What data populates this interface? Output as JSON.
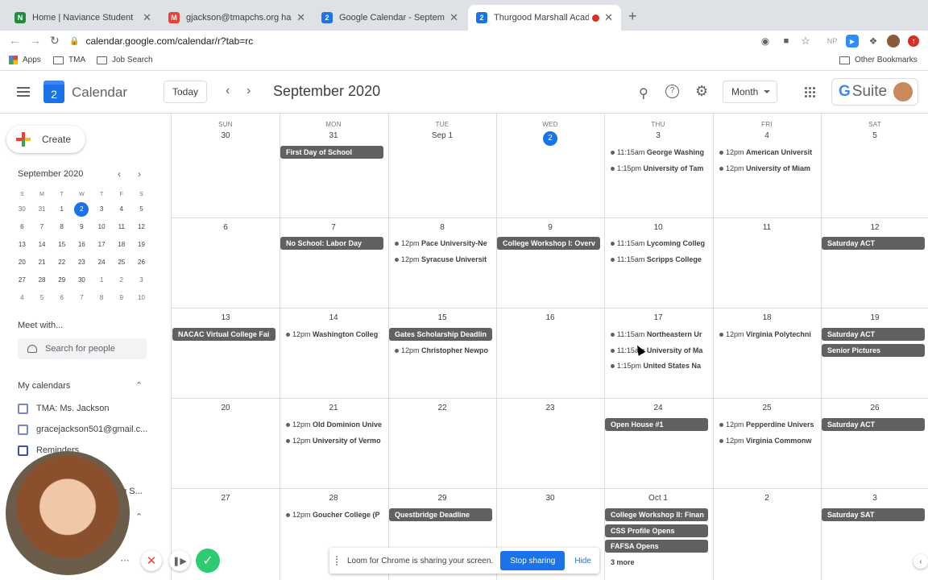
{
  "browser": {
    "tabs": [
      {
        "title": "Home | Naviance Student",
        "favicon_color": "#1e8e3e",
        "favicon": "N"
      },
      {
        "title": "gjackson@tmapchs.org has sh",
        "favicon_color": "#ea4335",
        "favicon": "M"
      },
      {
        "title": "Google Calendar - September",
        "favicon_color": "#1a73e8",
        "favicon": "2"
      },
      {
        "title": "Thurgood Marshall Academ",
        "favicon_color": "#1a73e8",
        "favicon": "2",
        "active": true
      }
    ],
    "url": "calendar.google.com/calendar/r?tab=rc",
    "bookmarks": [
      {
        "label": "Apps",
        "icon": "apps-grid-icon"
      },
      {
        "label": "TMA",
        "icon": "folder-icon"
      },
      {
        "label": "Job Search",
        "icon": "folder-icon"
      }
    ],
    "other_bookmarks": "Other Bookmarks",
    "ext_np": "NP"
  },
  "header": {
    "logo_day": "2",
    "app_name": "Calendar",
    "today_label": "Today",
    "title": "September 2020",
    "view_label": "Month",
    "gsuite_label": "Suite",
    "gsuite_g": "G"
  },
  "sidebar": {
    "create_label": "Create",
    "mini_title": "September 2020",
    "mini_dow": [
      "S",
      "M",
      "T",
      "W",
      "T",
      "F",
      "S"
    ],
    "mini_weeks": [
      [
        "30",
        "31",
        "1",
        "2",
        "3",
        "4",
        "5"
      ],
      [
        "6",
        "7",
        "8",
        "9",
        "10",
        "11",
        "12"
      ],
      [
        "13",
        "14",
        "15",
        "16",
        "17",
        "18",
        "19"
      ],
      [
        "20",
        "21",
        "22",
        "23",
        "24",
        "25",
        "26"
      ],
      [
        "27",
        "28",
        "29",
        "30",
        "1",
        "2",
        "3"
      ],
      [
        "4",
        "5",
        "6",
        "7",
        "8",
        "9",
        "10"
      ]
    ],
    "meet_with": "Meet with...",
    "search_people": "Search for people",
    "my_calendars": "My calendars",
    "calendars": [
      {
        "label": "TMA: Ms. Jackson",
        "color": "#7986cb"
      },
      {
        "label": "gracejackson501@gmail.c...",
        "color": "#7986cb"
      },
      {
        "label": "Reminders",
        "color": "#3f51b5"
      }
    ],
    "partial_label": "ng S..."
  },
  "grid": {
    "dow": [
      "SUN",
      "MON",
      "TUE",
      "WED",
      "THU",
      "FRI",
      "SAT"
    ],
    "weeks": [
      [
        "30",
        "31",
        "Sep 1",
        "2",
        "3",
        "4",
        "5"
      ],
      [
        "6",
        "7",
        "8",
        "9",
        "10",
        "11",
        "12"
      ],
      [
        "13",
        "14",
        "15",
        "16",
        "17",
        "18",
        "19"
      ],
      [
        "20",
        "21",
        "22",
        "23",
        "24",
        "25",
        "26"
      ],
      [
        "27",
        "28",
        "29",
        "30",
        "Oct 1",
        "2",
        "3"
      ]
    ],
    "events": [
      {
        "week": 0,
        "day": 1,
        "slot": 0,
        "type": "bar",
        "title": "First Day of School"
      },
      {
        "week": 0,
        "day": 4,
        "slot": 0,
        "type": "dot",
        "time": "11:15am",
        "title": "George Washing"
      },
      {
        "week": 0,
        "day": 4,
        "slot": 1,
        "type": "dot",
        "time": "1:15pm",
        "title": "University of Tam"
      },
      {
        "week": 0,
        "day": 5,
        "slot": 0,
        "type": "dot",
        "time": "12pm",
        "title": "American Universit"
      },
      {
        "week": 0,
        "day": 5,
        "slot": 1,
        "type": "dot",
        "time": "12pm",
        "title": "University of Miam"
      },
      {
        "week": 1,
        "day": 1,
        "slot": 0,
        "type": "bar",
        "title": "No School: Labor Day"
      },
      {
        "week": 1,
        "day": 2,
        "slot": 0,
        "type": "dot",
        "time": "12pm",
        "title": "Pace University-Ne"
      },
      {
        "week": 1,
        "day": 2,
        "slot": 1,
        "type": "dot",
        "time": "12pm",
        "title": "Syracuse Universit"
      },
      {
        "week": 1,
        "day": 3,
        "slot": 0,
        "type": "bar",
        "title": "College Workshop I: Overv"
      },
      {
        "week": 1,
        "day": 4,
        "slot": 0,
        "type": "dot",
        "time": "11:15am",
        "title": "Lycoming Colleg"
      },
      {
        "week": 1,
        "day": 4,
        "slot": 1,
        "type": "dot",
        "time": "11:15am",
        "title": "Scripps College"
      },
      {
        "week": 1,
        "day": 6,
        "slot": 0,
        "type": "bar",
        "title": "Saturday ACT"
      },
      {
        "week": 2,
        "day": 0,
        "slot": 0,
        "type": "bar",
        "title": "NACAC Virtual College Fai"
      },
      {
        "week": 2,
        "day": 1,
        "slot": 0,
        "type": "dot",
        "time": "12pm",
        "title": "Washington Colleg"
      },
      {
        "week": 2,
        "day": 2,
        "slot": 0,
        "type": "bar",
        "title": "Gates Scholarship Deadlin"
      },
      {
        "week": 2,
        "day": 2,
        "slot": 1,
        "type": "dot",
        "time": "12pm",
        "title": "Christopher Newpo"
      },
      {
        "week": 2,
        "day": 4,
        "slot": 0,
        "type": "dot",
        "time": "11:15am",
        "title": "Northeastern Ur"
      },
      {
        "week": 2,
        "day": 4,
        "slot": 1,
        "type": "dot",
        "time": "11:15am",
        "title": "University of Ma"
      },
      {
        "week": 2,
        "day": 4,
        "slot": 2,
        "type": "dot",
        "time": "1:15pm",
        "title": "United States Na"
      },
      {
        "week": 2,
        "day": 5,
        "slot": 0,
        "type": "dot",
        "time": "12pm",
        "title": "Virginia Polytechni"
      },
      {
        "week": 2,
        "day": 6,
        "slot": 0,
        "type": "bar",
        "title": "Saturday ACT"
      },
      {
        "week": 2,
        "day": 6,
        "slot": 1,
        "type": "bar",
        "title": "Senior Pictures"
      },
      {
        "week": 3,
        "day": 1,
        "slot": 0,
        "type": "dot",
        "time": "12pm",
        "title": "Old Dominion Unive"
      },
      {
        "week": 3,
        "day": 1,
        "slot": 1,
        "type": "dot",
        "time": "12pm",
        "title": "University of Vermo"
      },
      {
        "week": 3,
        "day": 4,
        "slot": 0,
        "type": "bar",
        "title": "Open House #1"
      },
      {
        "week": 3,
        "day": 5,
        "slot": 0,
        "type": "dot",
        "time": "12pm",
        "title": "Pepperdine Univers"
      },
      {
        "week": 3,
        "day": 5,
        "slot": 1,
        "type": "dot",
        "time": "12pm",
        "title": "Virginia Commonw"
      },
      {
        "week": 3,
        "day": 6,
        "slot": 0,
        "type": "bar",
        "title": "Saturday ACT"
      },
      {
        "week": 4,
        "day": 1,
        "slot": 0,
        "type": "dot",
        "time": "12pm",
        "title": "Goucher College (P"
      },
      {
        "week": 4,
        "day": 2,
        "slot": 0,
        "type": "bar",
        "title": "Questbridge Deadline"
      },
      {
        "week": 4,
        "day": 4,
        "slot": 0,
        "type": "bar",
        "title": "College Workshop II: Finan"
      },
      {
        "week": 4,
        "day": 4,
        "slot": 1,
        "type": "bar",
        "title": "CSS Profile Opens"
      },
      {
        "week": 4,
        "day": 4,
        "slot": 2,
        "type": "bar",
        "title": "FAFSA Opens"
      },
      {
        "week": 4,
        "day": 4,
        "slot": 3,
        "type": "more",
        "title": "3 more"
      },
      {
        "week": 4,
        "day": 6,
        "slot": 0,
        "type": "bar",
        "title": "Saturday SAT"
      }
    ]
  },
  "loom": {
    "message": "Loom for Chrome is sharing your screen.",
    "stop_label": "Stop sharing",
    "hide_label": "Hide"
  },
  "colors": {
    "accent": "#1a73e8",
    "event": "#616161"
  }
}
